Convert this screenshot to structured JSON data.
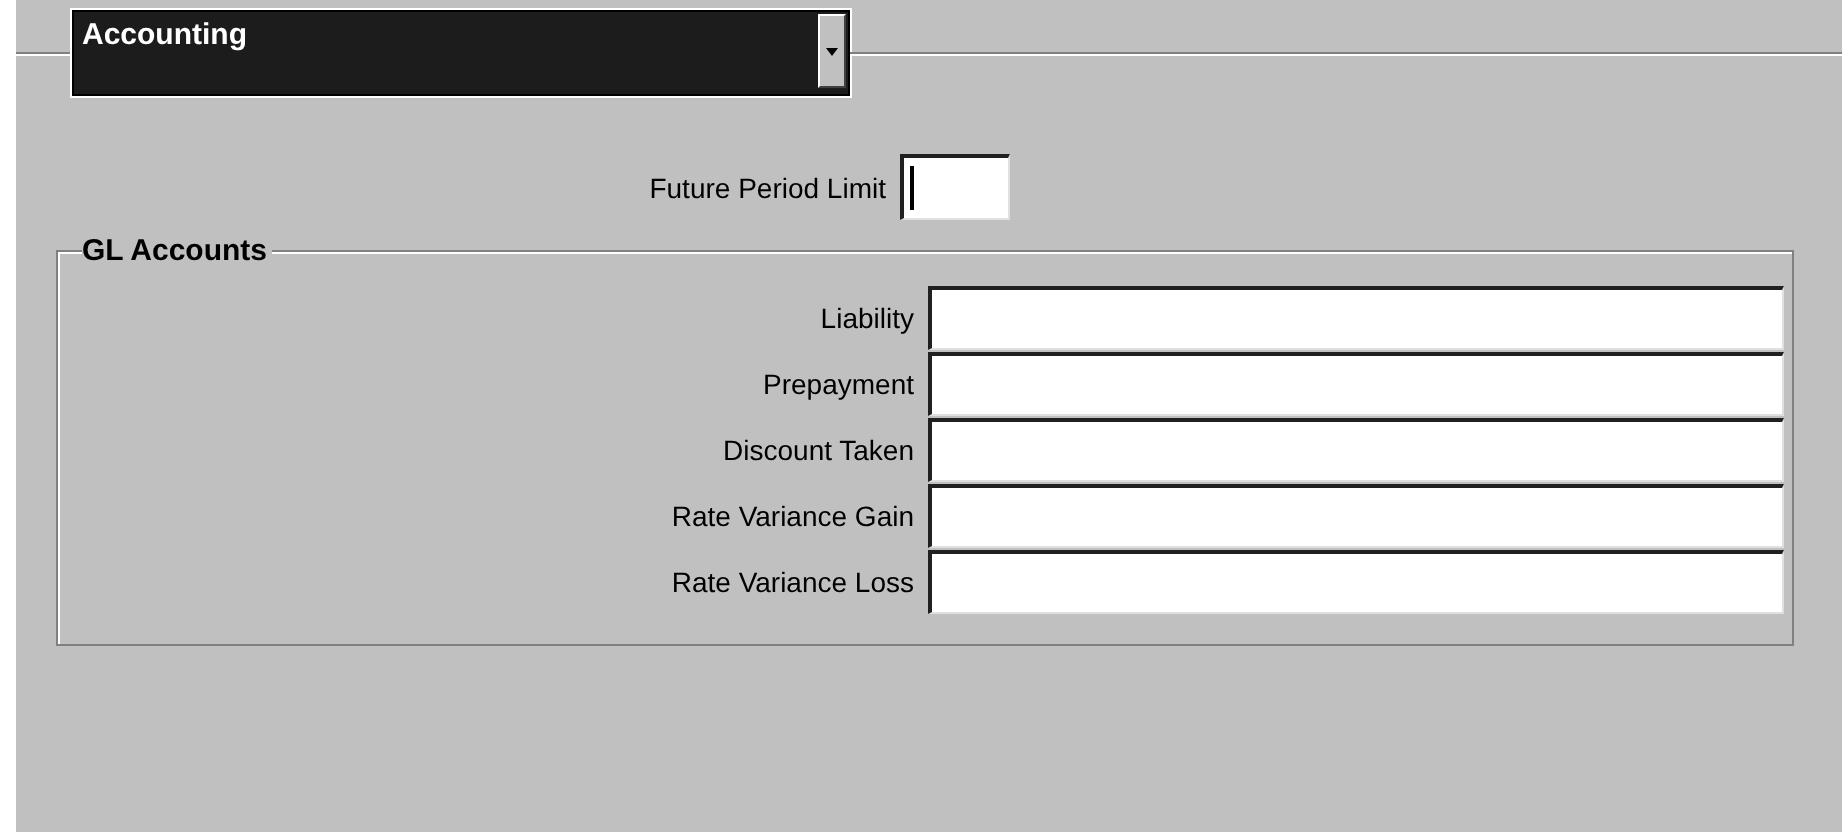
{
  "region_selector": {
    "value": "Accounting"
  },
  "future_period_limit": {
    "label": "Future Period Limit"
  },
  "gl_accounts": {
    "title": "GL Accounts",
    "fields": [
      {
        "label": "Liability"
      },
      {
        "label": "Prepayment"
      },
      {
        "label": "Discount Taken"
      },
      {
        "label": "Rate Variance Gain"
      },
      {
        "label": "Rate Variance Loss"
      }
    ]
  }
}
